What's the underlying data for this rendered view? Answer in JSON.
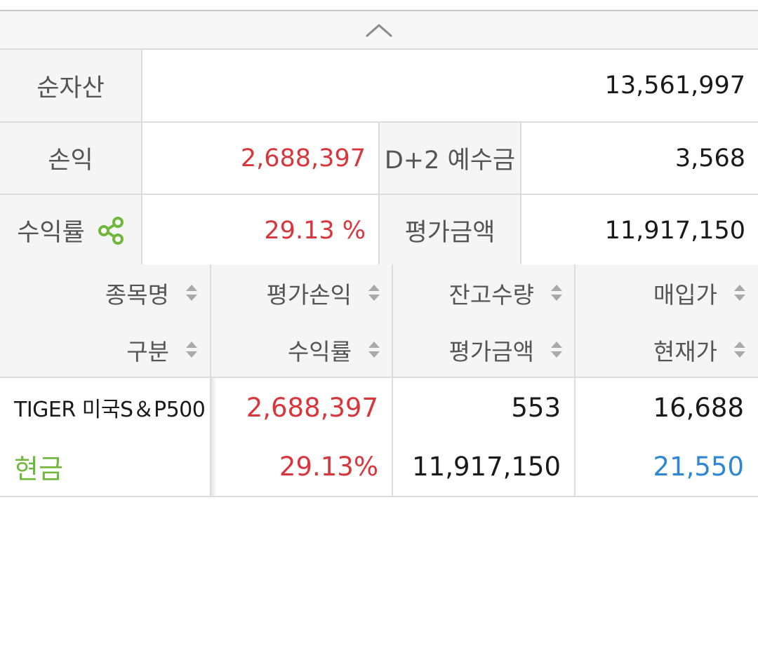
{
  "summary": {
    "net_assets_label": "순자산",
    "net_assets_value": "13,561,997",
    "profit_label": "손익",
    "profit_value": "2,688,397",
    "deposit_label": "D+2 예수금",
    "deposit_value": "3,568",
    "return_label": "수익률",
    "return_value": "29.13 %",
    "eval_label": "평가금액",
    "eval_value": "11,917,150"
  },
  "holdings": {
    "headers": {
      "name": "종목명",
      "type": "구분",
      "eval_profit": "평가손익",
      "return_rate": "수익률",
      "quantity": "잔고수량",
      "eval_amount": "평가금액",
      "purchase_price": "매입가",
      "current_price": "현재가"
    },
    "rows": [
      {
        "name": "TIGER 미국S＆P500",
        "type": "현금",
        "eval_profit": "2,688,397",
        "return_rate": "29.13%",
        "quantity": "553",
        "eval_amount": "11,917,150",
        "purchase_price": "16,688",
        "current_price": "21,550"
      }
    ]
  },
  "colors": {
    "profit_red": "#d8363c",
    "price_blue": "#2f86d2",
    "cash_green": "#6fb83b",
    "label_bg": "#f5f5f5",
    "border": "#dcdcdc"
  },
  "icons": {
    "collapse": "chevron-up-icon",
    "share": "share-icon",
    "sort": "sort-arrows-icon"
  }
}
